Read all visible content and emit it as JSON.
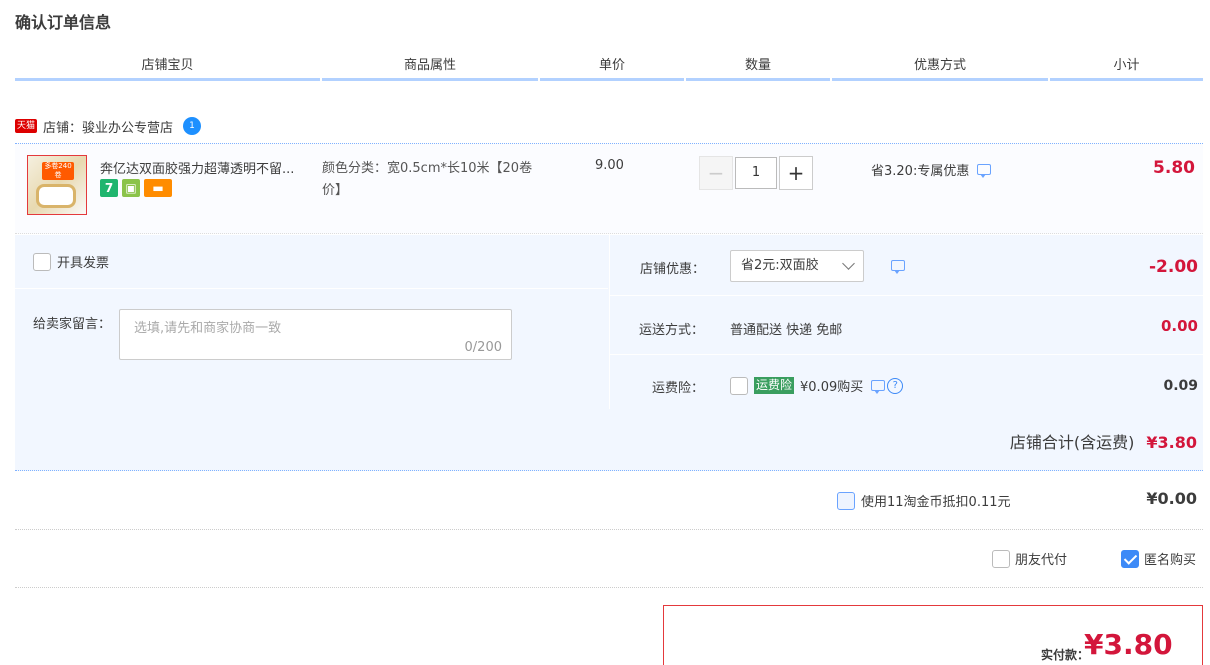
{
  "page": {
    "title": "确认订单信息"
  },
  "columns": [
    "店铺宝贝",
    "商品属性",
    "单价",
    "数量",
    "优惠方式",
    "小计"
  ],
  "shop": {
    "badge": "天猫",
    "label": "店铺：骏业办公专营店",
    "chat_badge": "1"
  },
  "item": {
    "title": "奔亿达双面胶强力超薄透明不留...",
    "thumb_badge": "多卷240卷",
    "attr": "颜色分类：宽0.5cm*长10米【20卷价】",
    "price": "9.00",
    "qty_minus": "−",
    "qty": "1",
    "qty_plus": "+",
    "promo": "省3.20:专属优惠",
    "subtotal": "5.80",
    "icons": [
      "seven-day-icon",
      "guarantee-icon",
      "credit-card-icon"
    ]
  },
  "options": {
    "invoice_label": "开具发票",
    "message_label": "给卖家留言：",
    "message_placeholder": "选填,请先和商家协商一致",
    "message_count": "0/200",
    "shop_discount_label": "店铺优惠：",
    "shop_discount_select": "省2元:双面胶",
    "shop_discount_value": "-2.00",
    "shipping_label": "运送方式：",
    "shipping_text": "普通配送 快递 免邮",
    "shipping_value": "0.00",
    "insurance_label": "运费险：",
    "insurance_tag": "运费险",
    "insurance_text": "¥0.09购买",
    "insurance_value": "0.09",
    "shop_total_label": "店铺合计(含运费)",
    "shop_total_value": "¥3.80"
  },
  "coins": {
    "label": "使用11淘金币抵扣0.11元",
    "value": "¥0.00"
  },
  "pay_options": {
    "friend_label": "朋友代付",
    "anon_label": "匿名购买",
    "anon_checked": true
  },
  "final": {
    "label": "实付款：",
    "amount": "¥3.80"
  },
  "colors": {
    "accent": "#d3163b",
    "header_line": "#b2d1ff",
    "panel_bg": "#f2f7ff"
  }
}
